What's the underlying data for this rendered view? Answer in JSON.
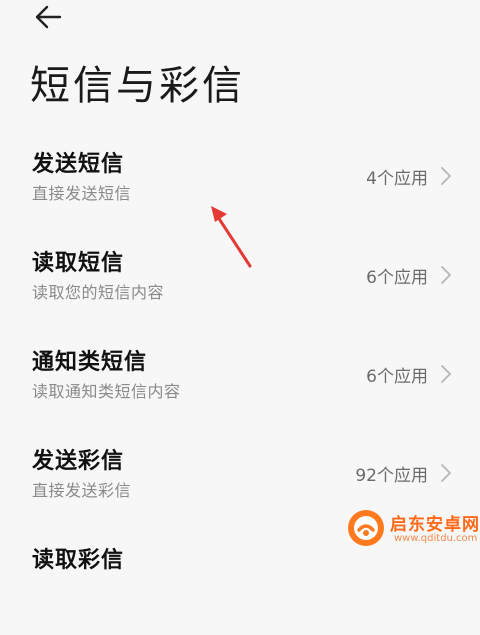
{
  "header": {
    "back_icon": "arrow-left-icon",
    "title": "短信与彩信"
  },
  "items": [
    {
      "title": "发送短信",
      "subtitle": "直接发送短信",
      "value": "4个应用"
    },
    {
      "title": "读取短信",
      "subtitle": "读取您的短信内容",
      "value": "6个应用"
    },
    {
      "title": "通知类短信",
      "subtitle": "读取通知类短信内容",
      "value": "6个应用"
    },
    {
      "title": "发送彩信",
      "subtitle": "直接发送彩信",
      "value": "92个应用"
    },
    {
      "title": "读取彩信",
      "subtitle": "",
      "value": ""
    }
  ],
  "colors": {
    "background": "#f7f7f7",
    "annotation_arrow": "#e53935",
    "watermark": "#ff6a1a"
  },
  "watermark": {
    "text": "启东安卓网",
    "url": "www.qditdu.com"
  }
}
